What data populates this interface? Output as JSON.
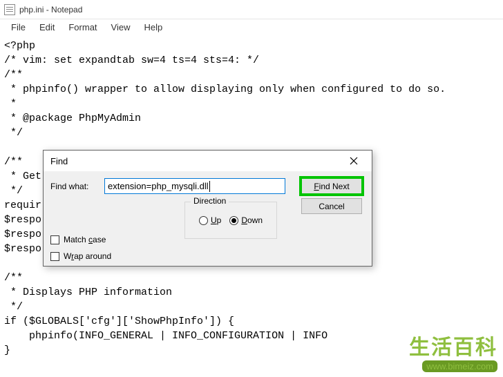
{
  "window": {
    "title": "php.ini - Notepad"
  },
  "menu": {
    "file": "File",
    "edit": "Edit",
    "format": "Format",
    "view": "View",
    "help": "Help"
  },
  "editor": {
    "content": "<?php\n/* vim: set expandtab sw=4 ts=4 sts=4: */\n/**\n * phpinfo() wrapper to allow displaying only when configured to do so.\n *\n * @package PhpMyAdmin\n */\n\n/**\n * Get\n */\nrequir\n$respo\n$respo\n$respo\n\n/**\n * Displays PHP information\n */\nif ($GLOBALS['cfg']['ShowPhpInfo']) {\n    phpinfo(INFO_GENERAL | INFO_CONFIGURATION | INFO\n}"
  },
  "dialog": {
    "title": "Find",
    "find_label": "Find what:",
    "find_value": "extension=php_mysqli.dll",
    "direction_label": "Direction",
    "up_label": "Up",
    "down_label": "Down",
    "match_case_label": "Match case",
    "wrap_around_label": "Wrap around",
    "find_next_label": "Find Next",
    "cancel_label": "Cancel",
    "direction": "down",
    "match_case": false,
    "wrap_around": false
  },
  "watermark": {
    "main": "生活百科",
    "url": "www.bimeiz.com"
  }
}
